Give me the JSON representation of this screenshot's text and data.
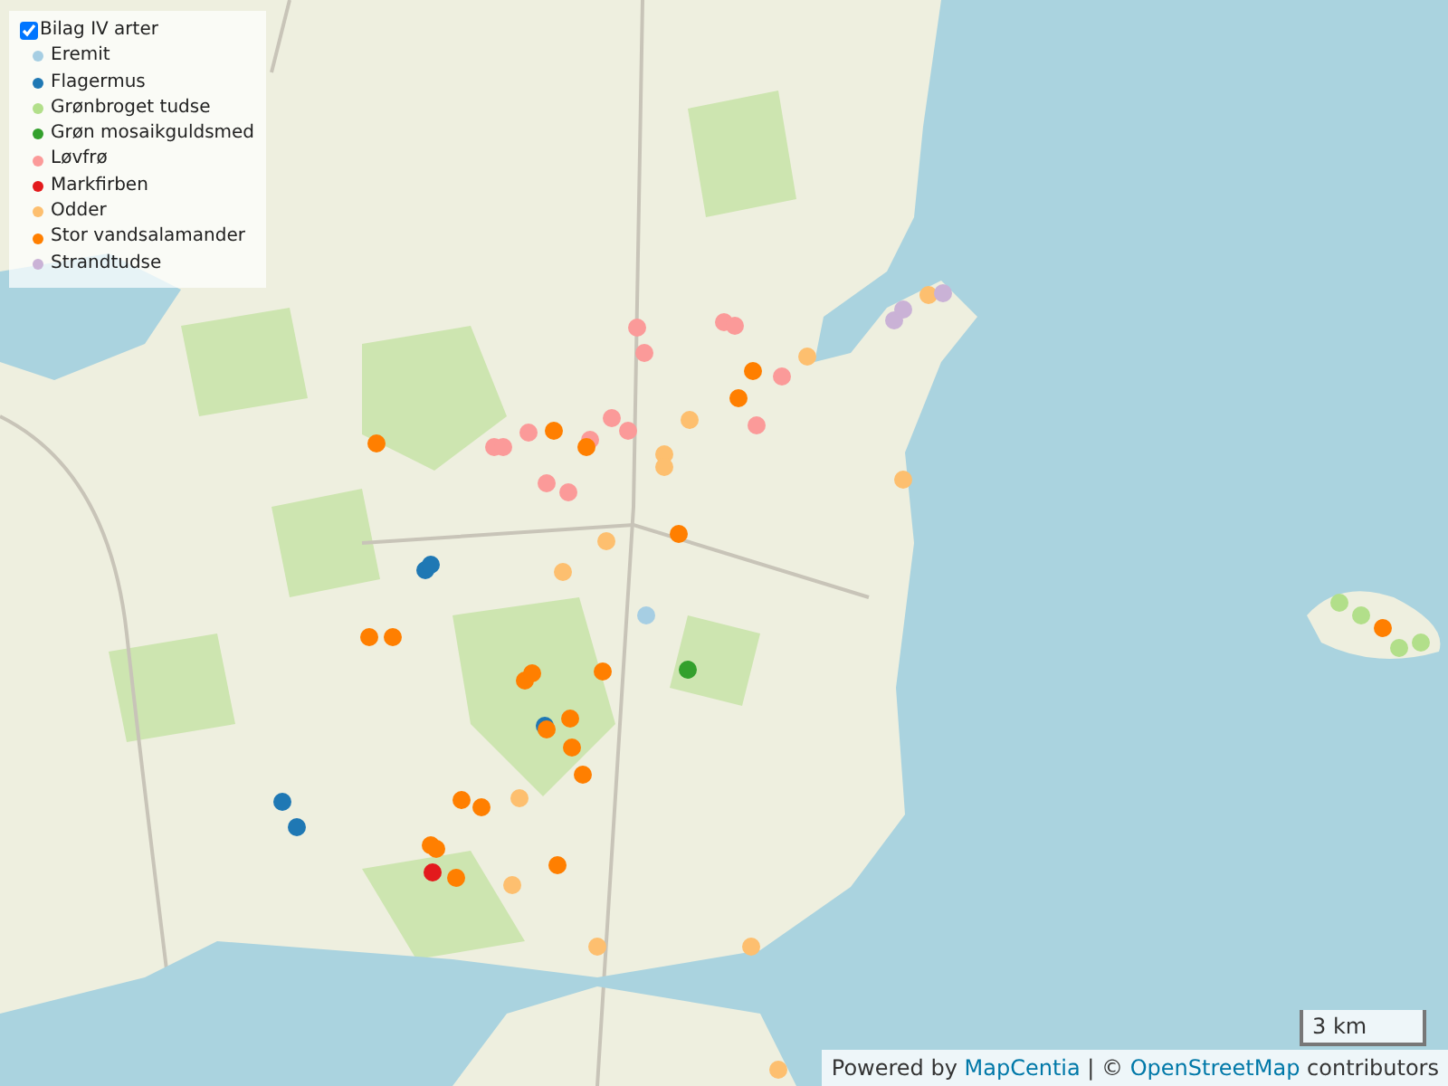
{
  "legend": {
    "title": "Bilag IV arter",
    "checked": true,
    "items": [
      {
        "label": "Eremit",
        "color": "#a6cee3"
      },
      {
        "label": "Flagermus",
        "color": "#1f78b4"
      },
      {
        "label": "Grønbroget tudse",
        "color": "#b2df8a"
      },
      {
        "label": "Grøn mosaikguldsmed",
        "color": "#33a02c"
      },
      {
        "label": "Løvfrø",
        "color": "#fb9a99"
      },
      {
        "label": "Markfirben",
        "color": "#e31a1c"
      },
      {
        "label": "Odder",
        "color": "#fdbf6f"
      },
      {
        "label": "Stor vandsalamander",
        "color": "#ff7f00"
      },
      {
        "label": "Strandtudse",
        "color": "#cab2d6"
      }
    ]
  },
  "scale": "3 km",
  "attribution": {
    "prefix": "Powered by",
    "link_1": "MapCentia",
    "separator": "| ©",
    "link_2": "OpenStreetMap",
    "suffix": "contributors"
  }
}
